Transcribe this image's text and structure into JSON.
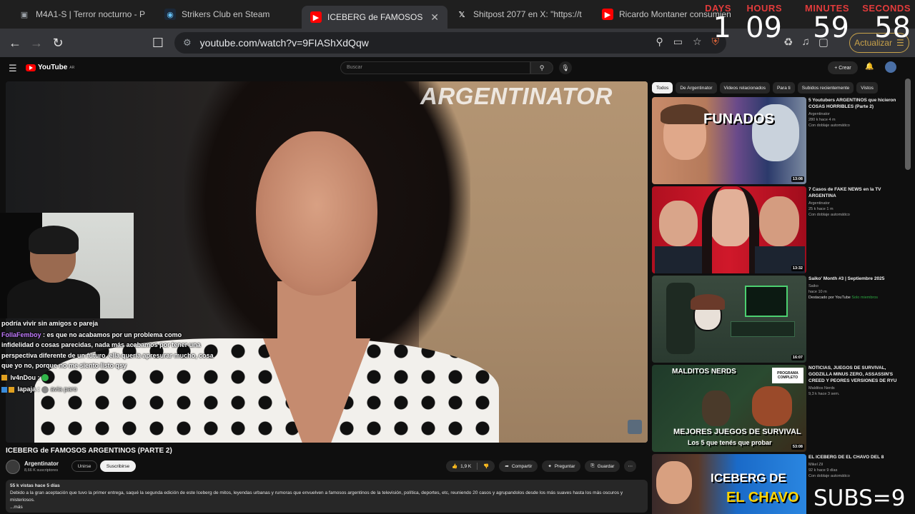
{
  "browser": {
    "tabs": [
      {
        "title": "M4A1-S | Terror nocturno - P",
        "favicon": "folder-icon",
        "active": false
      },
      {
        "title": "Strikers Club en Steam",
        "favicon": "steam-icon",
        "active": false
      },
      {
        "title": "ICEBERG de FAMOSOS AR",
        "favicon": "youtube-icon",
        "active": true
      },
      {
        "title": "Shitpost 2077 en X: \"https://t",
        "favicon": "x-icon",
        "active": false
      },
      {
        "title": "Ricardo Montaner consumien",
        "favicon": "youtube-icon",
        "active": false
      }
    ],
    "url": "youtube.com/watch?v=9FIAShXdQqw",
    "update_label": "Actualizar"
  },
  "countdown": {
    "days_label": "DAYS",
    "days": "1",
    "hours_label": "HOURS",
    "hours": "09",
    "minutes_label": "MINUTES",
    "minutes": "59",
    "seconds_label": "SECONDS",
    "seconds": "58"
  },
  "youtube": {
    "logo": "YouTube",
    "region": "AR",
    "search_placeholder": "Buscar",
    "create_label": "+ Crear"
  },
  "video": {
    "watermark": "ARGENTINATOR",
    "title": "ICEBERG de FAMOSOS ARGENTINOS (PARTE 2)",
    "channel": "Argentinator",
    "subscribers": "8,66 K suscriptores",
    "join_label": "Unirse",
    "subscribe_label": "Suscribirse",
    "likes": "1,9 K",
    "share_label": "Compartir",
    "ask_label": "Preguntar",
    "save_label": "Guardar",
    "views_date": "55 k vistas  hace 5 días",
    "description": "Debido a la gran aceptación que tuvo la primer entrega, saqué la segunda edición de este Iceberg de mitos, leyendas urbanas y rumoras que envuelven a famosos argentinos de la televisión, política, deportes, etc, reuniendo 20 casos y agrupandolos desde los más suaves hasta los más oscuros y misteriosos.",
    "more": "...más"
  },
  "chat": {
    "line1": "podría vivir sin amigos o pareja",
    "line2_user": "FollaFemboy",
    "line2_msg": ": es que no acabamos por un problema como infidelidad o cosas parecidas, nada más acabamos por tener una perspectiva diferente de un futuro. ella quería apresurar mucho, cosa que yo no, porque no me siento listo qsy",
    "line3_user": "lv4nDou",
    "line3_msg": ":",
    "line4_user": "lapaja",
    "line4_msg": "avia paro"
  },
  "sidebar": {
    "chips": [
      "Todos",
      "De Argentinator",
      "Videos relacionados",
      "Para ti",
      "Subidos recientemente",
      "Vistos"
    ],
    "recommendations": [
      {
        "title": "5 Youtubers ARGENTINOS que hicieron COSAS HORRIBLES (Parte 2)",
        "channel": "Argentinator",
        "meta": "280 k  hace 4 m",
        "tag": "Con doblaje automático",
        "duration": "13:08",
        "thumb_text": "FUNADOS"
      },
      {
        "title": "7 Casos de FAKE NEWS en la TV ARGENTINA",
        "channel": "Argentinator",
        "meta": "25 k  hace 1 m",
        "tag": "Con doblaje automático",
        "duration": "13:32",
        "thumb_text": ""
      },
      {
        "title": "Saiko' Month #3 | Septiembre 2025",
        "channel": "Saiko",
        "meta": "hace 10 m",
        "tag": "Destacado por YouTube",
        "tag_extra": "Solo miembros",
        "duration": "16:07",
        "thumb_text": ""
      },
      {
        "title": "NOTICIAS, JUEGOS DE SURVIVAL, GODZILLA MINUS ZERO, ASSASSIN'S CREED Y PEORES VERSIONES DE RYU",
        "channel": "Malditos Nerds",
        "meta": "9,3 k  hace 3 sem.",
        "tag": "",
        "duration": "53:08",
        "thumb_text": "MEJORES JUEGOS DE SURVIVAL",
        "thumb_sub": "Los 5 que tenés que probar",
        "thumb_top": "MALDITOS NERDS",
        "thumb_badge": "PROGRAMA COMPLETO"
      },
      {
        "title": "EL ICEBERG DE EL CHAVO DEL 8",
        "channel": "Mikel Zil",
        "meta": "92 k  hace 9 días",
        "tag": "Con doblaje automático",
        "duration": "",
        "thumb_text": "ICEBERG DE",
        "thumb_sub": "EL CHAVO"
      }
    ]
  },
  "overlay": {
    "subs": "SUBS=9"
  }
}
